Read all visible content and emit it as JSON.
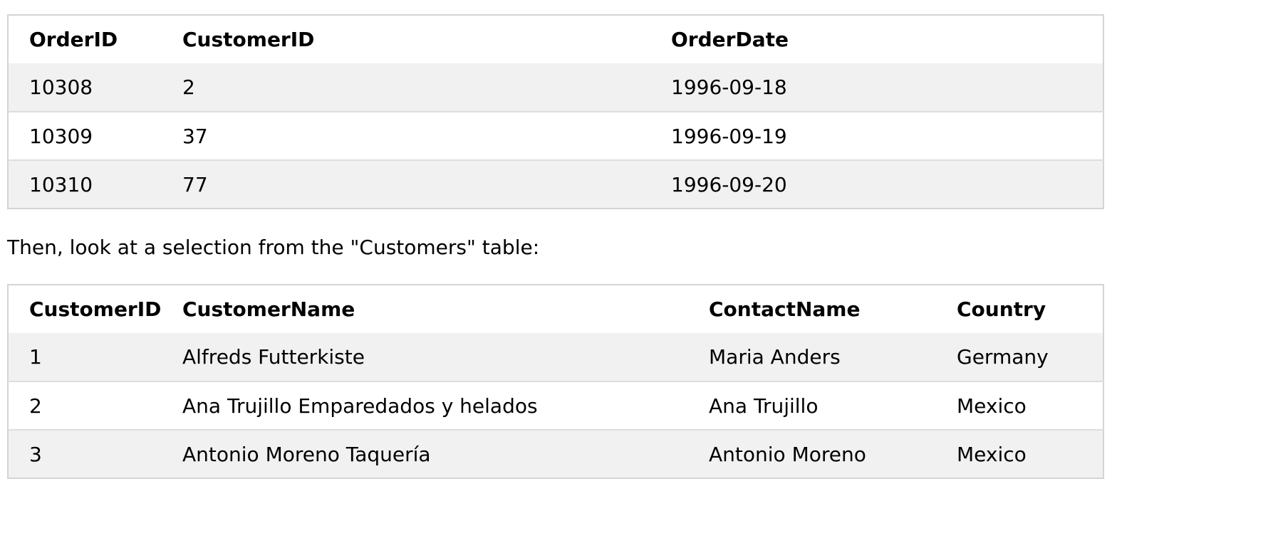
{
  "orders_table": {
    "headers": [
      "OrderID",
      "CustomerID",
      "OrderDate"
    ],
    "rows": [
      [
        "10308",
        "2",
        "1996-09-18"
      ],
      [
        "10309",
        "37",
        "1996-09-19"
      ],
      [
        "10310",
        "77",
        "1996-09-20"
      ]
    ]
  },
  "intro_text": "Then, look at a selection from the \"Customers\" table:",
  "customers_table": {
    "headers": [
      "CustomerID",
      "CustomerName",
      "ContactName",
      "Country"
    ],
    "rows": [
      [
        "1",
        "Alfreds Futterkiste",
        "Maria Anders",
        "Germany"
      ],
      [
        "2",
        "Ana Trujillo Emparedados y helados",
        "Ana Trujillo",
        "Mexico"
      ],
      [
        "3",
        "Antonio Moreno Taquería",
        "Antonio Moreno",
        "Mexico"
      ]
    ]
  }
}
